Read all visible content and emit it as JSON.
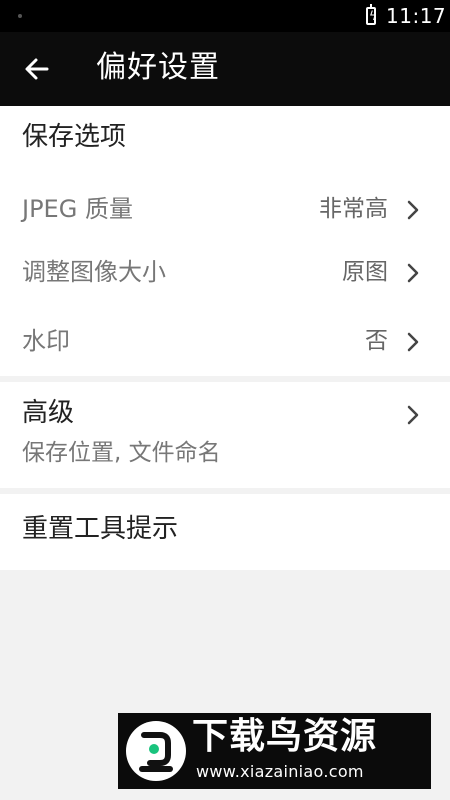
{
  "status_bar": {
    "time": "11:17"
  },
  "app_bar": {
    "title": "偏好设置"
  },
  "save_options": {
    "title": "保存选项",
    "items": [
      {
        "label": "JPEG 质量",
        "value": "非常高"
      },
      {
        "label": "调整图像大小",
        "value": "原图"
      },
      {
        "label": "水印",
        "value": "否"
      }
    ]
  },
  "advanced": {
    "title": "高级",
    "subtitle": "保存位置, 文件命名"
  },
  "reset": {
    "title": "重置工具提示"
  },
  "watermark": {
    "cn": "下载鸟资源",
    "url": "www.xiazainiao.com"
  }
}
